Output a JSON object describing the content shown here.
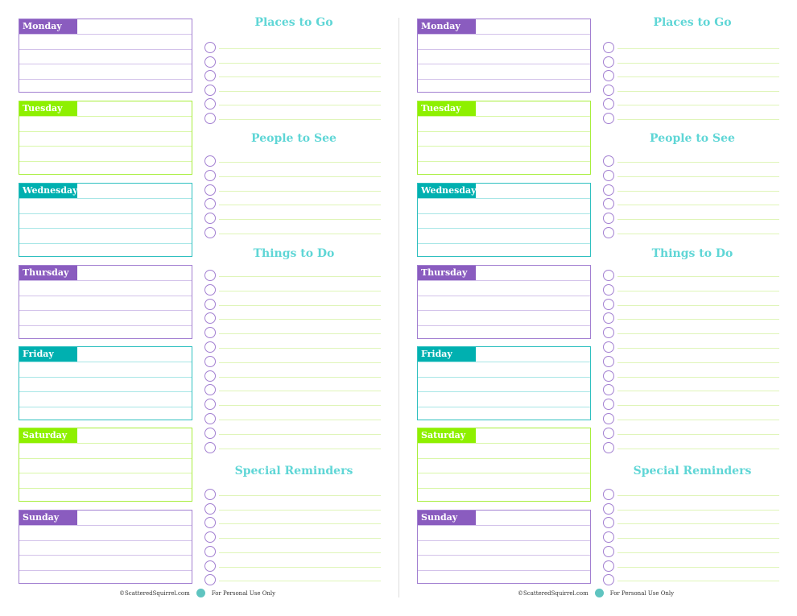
{
  "days": [
    {
      "label": "Monday",
      "color": "#8a5cbf",
      "border": "#a27fd1",
      "row": "#d3c2ea"
    },
    {
      "label": "Tuesday",
      "color": "#8ef000",
      "border": "#a8ee3c",
      "row": "#d9f7a8"
    },
    {
      "label": "Wednesday",
      "color": "#00b0b0",
      "border": "#2fc0c0",
      "row": "#a8e6e6"
    },
    {
      "label": "Thursday",
      "color": "#8a5cbf",
      "border": "#a27fd1",
      "row": "#d3c2ea"
    },
    {
      "label": "Friday",
      "color": "#00b0b0",
      "border": "#2fc0c0",
      "row": "#a8e6e6"
    },
    {
      "label": "Saturday",
      "color": "#8ef000",
      "border": "#a8ee3c",
      "row": "#d9f7a8"
    },
    {
      "label": "Sunday",
      "color": "#8a5cbf",
      "border": "#a27fd1",
      "row": "#d3c2ea"
    }
  ],
  "sections": [
    {
      "title": "Places to Go",
      "items": 6
    },
    {
      "title": "People to See",
      "items": 6
    },
    {
      "title": "Things to Do",
      "items": 13
    },
    {
      "title": "Special Reminders",
      "items": 7
    }
  ],
  "footer": {
    "site": "©ScatteredSquirrel.com",
    "note": "For Personal Use Only",
    "logo": "squirrel-icon"
  },
  "colors": {
    "title": "#5fd6d6",
    "circle": "#a27fd1",
    "line": "#dff5b8"
  }
}
